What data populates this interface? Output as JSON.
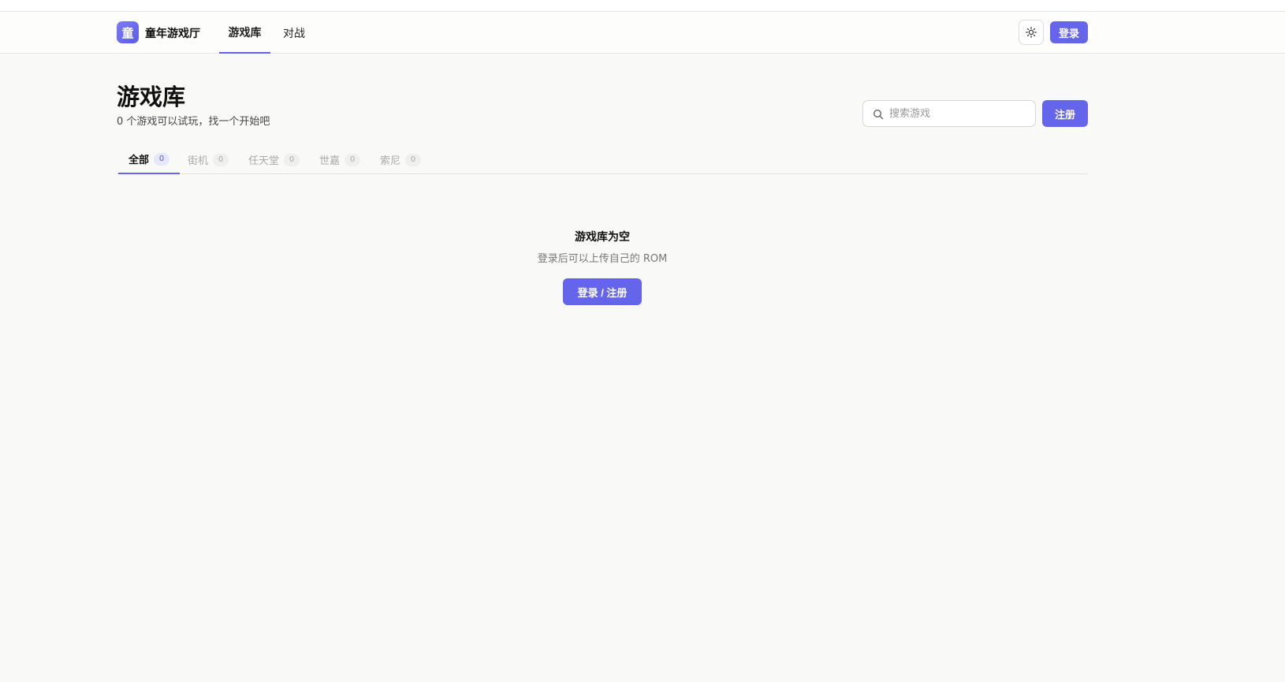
{
  "header": {
    "logo_char": "童",
    "brand": "童年游戏厅",
    "nav": [
      {
        "label": "游戏库",
        "active": true
      },
      {
        "label": "对战",
        "active": false
      }
    ],
    "theme_toggle_icon": "sun-icon",
    "login_label": "登录"
  },
  "page": {
    "title": "游戏库",
    "subtitle": "0 个游戏可以试玩，找一个开始吧"
  },
  "search": {
    "placeholder": "搜索游戏",
    "value": "",
    "icon": "search-icon"
  },
  "register_label": "注册",
  "filters": [
    {
      "label": "全部",
      "count": "0",
      "active": true
    },
    {
      "label": "街机",
      "count": "0",
      "active": false
    },
    {
      "label": "任天堂",
      "count": "0",
      "active": false
    },
    {
      "label": "世嘉",
      "count": "0",
      "active": false
    },
    {
      "label": "索尼",
      "count": "0",
      "active": false
    }
  ],
  "empty_state": {
    "title": "游戏库为空",
    "description": "登录后可以上传自己的 ROM",
    "button_label": "登录 / 注册"
  },
  "colors": {
    "accent": "#6565ec",
    "background": "#f9f9f8",
    "text": "#111111"
  }
}
